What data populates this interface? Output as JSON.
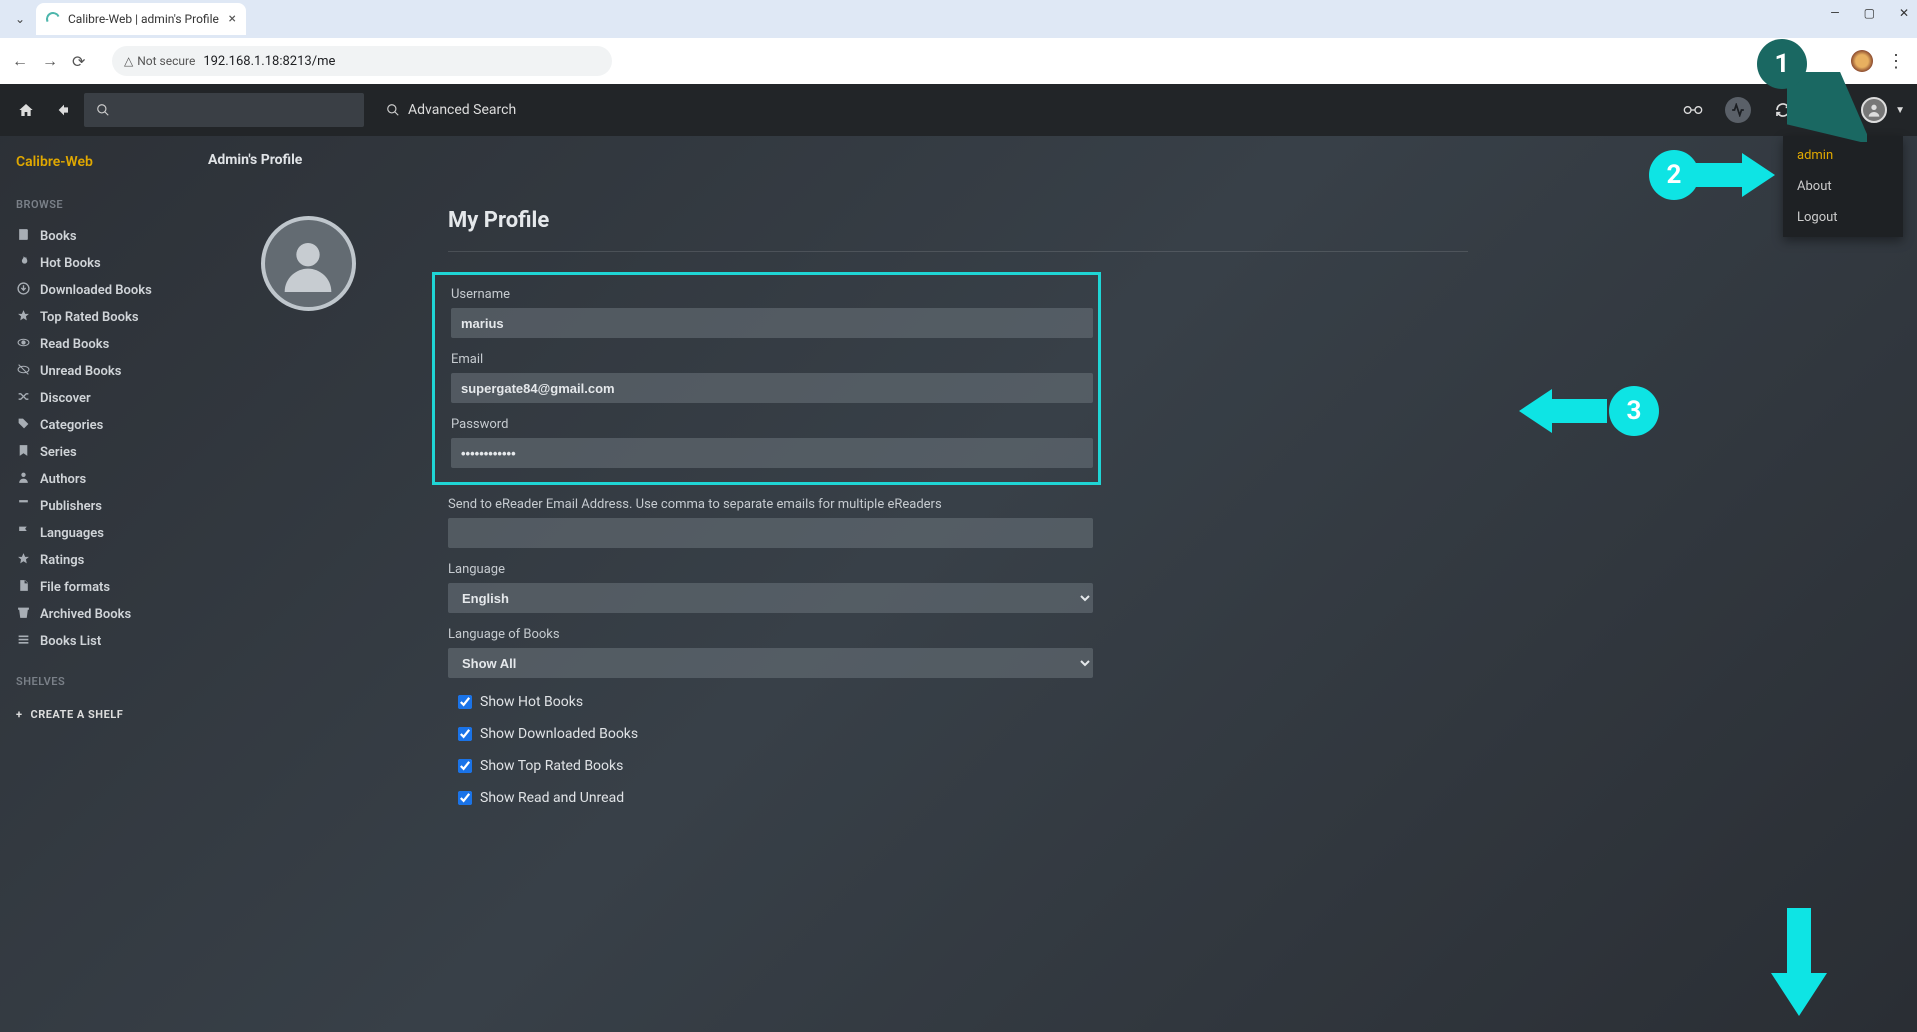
{
  "browser": {
    "tab_title": "Calibre-Web | admin's Profile",
    "not_secure_label": "Not secure",
    "url": "192.168.1.18:8213/me"
  },
  "appbar": {
    "advanced_search": "Advanced Search"
  },
  "profile_dropdown": {
    "items": [
      "admin",
      "About",
      "Logout"
    ]
  },
  "sidebar": {
    "brand": "Calibre-Web",
    "browse_label": "BROWSE",
    "shelves_label": "SHELVES",
    "create_shelf": "CREATE A SHELF",
    "items": [
      {
        "icon": "book",
        "label": "Books"
      },
      {
        "icon": "fire",
        "label": "Hot Books"
      },
      {
        "icon": "download",
        "label": "Downloaded Books"
      },
      {
        "icon": "star",
        "label": "Top Rated Books"
      },
      {
        "icon": "eye",
        "label": "Read Books"
      },
      {
        "icon": "eye-off",
        "label": "Unread Books"
      },
      {
        "icon": "shuffle",
        "label": "Discover"
      },
      {
        "icon": "tag",
        "label": "Categories"
      },
      {
        "icon": "bookmark",
        "label": "Series"
      },
      {
        "icon": "user",
        "label": "Authors"
      },
      {
        "icon": "publisher",
        "label": "Publishers"
      },
      {
        "icon": "flag",
        "label": "Languages"
      },
      {
        "icon": "star2",
        "label": "Ratings"
      },
      {
        "icon": "file",
        "label": "File formats"
      },
      {
        "icon": "archive",
        "label": "Archived Books"
      },
      {
        "icon": "list",
        "label": "Books List"
      }
    ]
  },
  "content": {
    "page_title": "Admin's Profile",
    "h2": "My Profile",
    "labels": {
      "username": "Username",
      "email": "Email",
      "password": "Password",
      "ereader": "Send to eReader Email Address. Use comma to separate emails for multiple eReaders",
      "language": "Language",
      "language_of_books": "Language of Books"
    },
    "values": {
      "username": "marius",
      "email": "supergate84@gmail.com",
      "password": "••••••••••••",
      "ereader": "",
      "language": "English",
      "language_of_books": "Show All"
    },
    "checkboxes": [
      "Show Hot Books",
      "Show Downloaded Books",
      "Show Top Rated Books",
      "Show Read and Unread"
    ]
  },
  "annotations": {
    "n1": "1",
    "n2": "2",
    "n3": "3"
  }
}
